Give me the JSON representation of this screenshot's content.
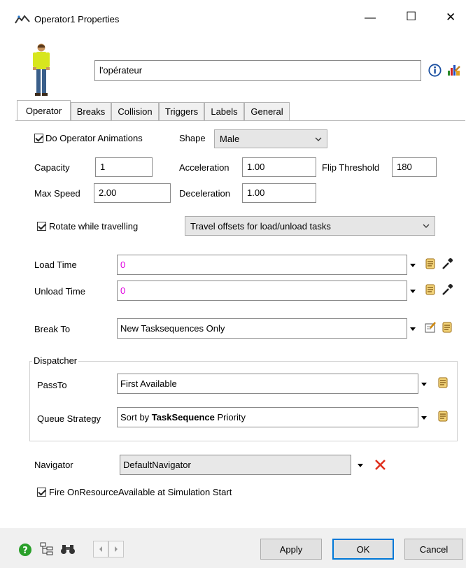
{
  "window": {
    "title": "Operator1  Properties",
    "minimize_glyph": "—",
    "maximize_glyph": "☐",
    "close_glyph": "✕"
  },
  "header": {
    "name_value": "l'opérateur",
    "info_icon": "info-icon",
    "tools_icon": "chart-tools-icon"
  },
  "tabs": [
    "Operator",
    "Breaks",
    "Collision",
    "Triggers",
    "Labels",
    "General"
  ],
  "operator": {
    "do_animations_label": "Do Operator Animations",
    "shape_label": "Shape",
    "shape_value": "Male",
    "capacity_label": "Capacity",
    "capacity_value": "1",
    "acceleration_label": "Acceleration",
    "acceleration_value": "1.00",
    "flip_threshold_label": "Flip Threshold",
    "flip_threshold_value": "180",
    "max_speed_label": "Max Speed",
    "max_speed_value": "2.00",
    "deceleration_label": "Deceleration",
    "deceleration_value": "1.00",
    "rotate_label": "Rotate while travelling",
    "travel_offsets_value": "Travel offsets for load/unload tasks",
    "load_time_label": "Load Time",
    "load_time_value": "0",
    "unload_time_label": "Unload Time",
    "unload_time_value": "0",
    "break_to_label": "Break To",
    "break_to_value": "New Tasksequences Only",
    "dispatcher_label": "Dispatcher",
    "passto_label": "PassTo",
    "passto_value": "First Available",
    "queue_strategy_label": "Queue Strategy",
    "queue_strategy_prefix": "Sort by ",
    "queue_strategy_bold": "TaskSequence",
    "queue_strategy_suffix": " Priority",
    "navigator_label": "Navigator",
    "navigator_value": "DefaultNavigator",
    "fire_label": "Fire OnResourceAvailable at Simulation Start"
  },
  "footer": {
    "apply_label": "Apply",
    "ok_label": "OK",
    "cancel_label": "Cancel"
  },
  "colors": {
    "accent": "#0078d7",
    "zero_value": "#e000e0",
    "delete_x": "#e0301e",
    "help_green": "#2aa02a"
  }
}
